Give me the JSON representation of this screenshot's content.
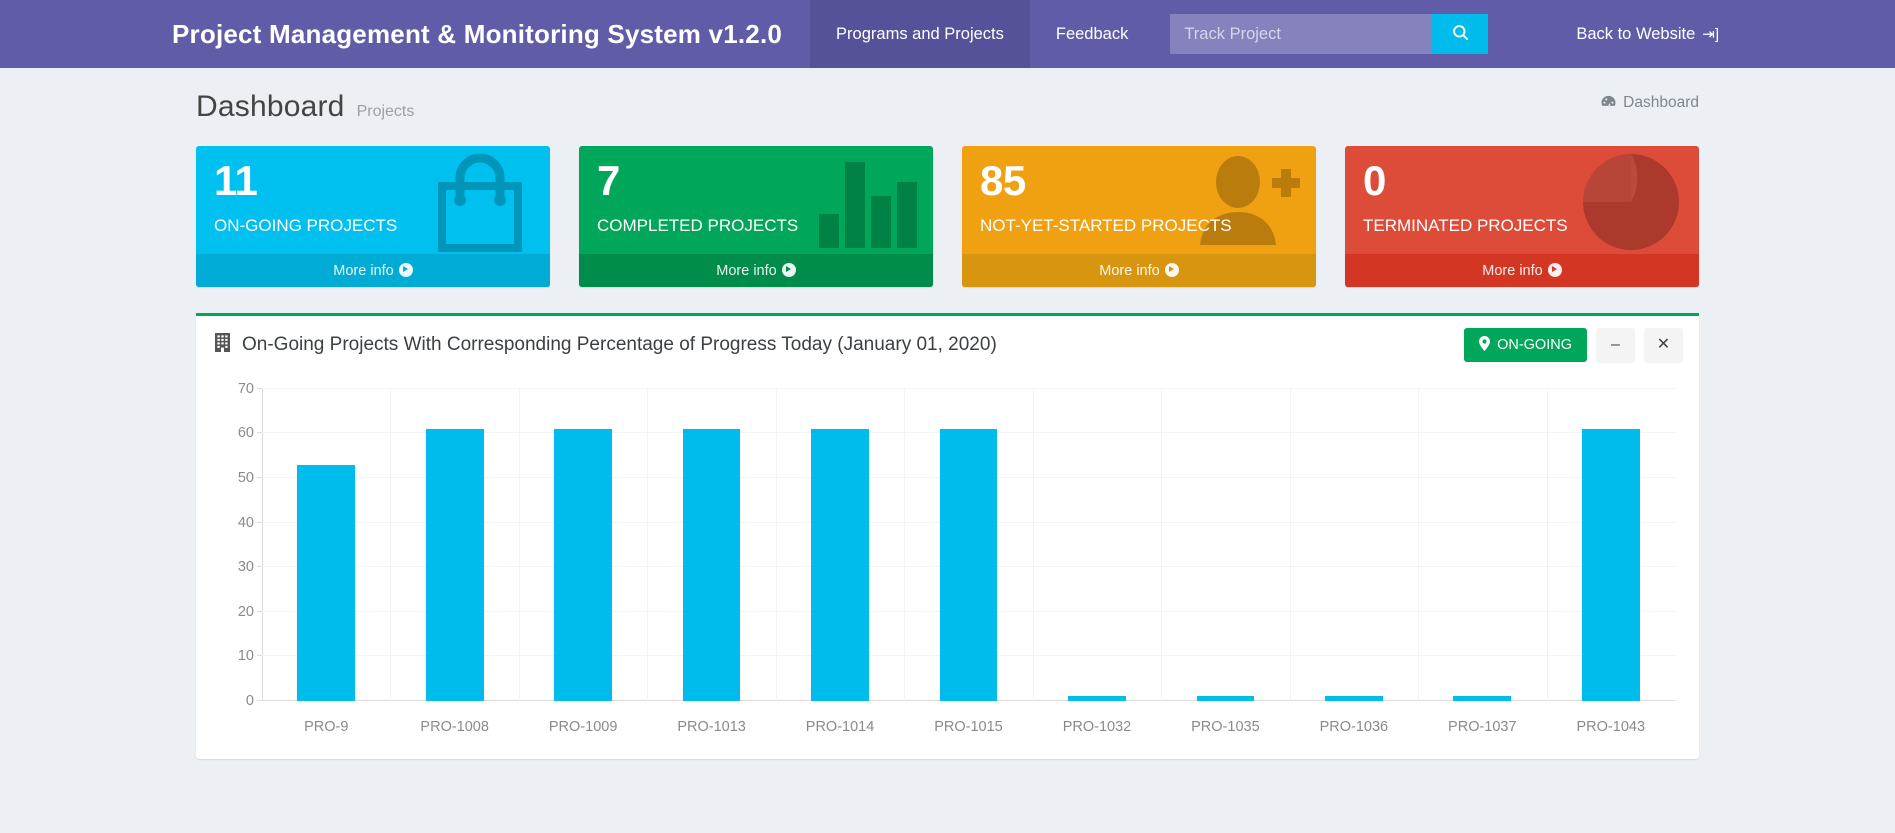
{
  "navbar": {
    "brand": "Project Management & Monitoring System v1.2.0",
    "links": [
      {
        "label": "Programs and Projects",
        "active": true
      },
      {
        "label": "Feedback",
        "active": false
      }
    ],
    "search": {
      "placeholder": "Track Project",
      "value": "",
      "icon": "search-icon",
      "button_color": "#00bcec"
    },
    "right_link": {
      "label": "Back to Website",
      "icon": "sign-out-icon"
    },
    "background": "#605ca8"
  },
  "page": {
    "title": "Dashboard",
    "subtitle": "Projects",
    "breadcrumb": {
      "icon": "dashboard-icon",
      "label": "Dashboard"
    }
  },
  "cards": [
    {
      "value": "11",
      "label": "ON-GOING PROJECTS",
      "more_info": "More info",
      "icon": "shopping-bag-icon",
      "color": "#00c0ef",
      "foot_color": "#00acd6"
    },
    {
      "value": "7",
      "label": "COMPLETED PROJECTS",
      "more_info": "More info",
      "icon": "bar-chart-icon",
      "color": "#00a65a",
      "foot_color": "#008d4c"
    },
    {
      "value": "85",
      "label": "NOT-YET-STARTED PROJECTS",
      "more_info": "More info",
      "icon": "user-plus-icon",
      "color": "#f0a112",
      "foot_color": "#d79510"
    },
    {
      "value": "0",
      "label": "TERMINATED PROJECTS",
      "more_info": "More info",
      "icon": "pie-chart-icon",
      "color": "#dd4b39",
      "foot_color": "#d33724"
    }
  ],
  "panel": {
    "title": "On-Going Projects With Corresponding Percentage of Progress Today (January 01, 2020)",
    "title_icon": "building-icon",
    "status_badge": {
      "label": "ON-GOING",
      "icon": "map-marker-icon",
      "color": "#00a65a"
    },
    "minimize_label": "–",
    "close_label": "✕",
    "accent": "#00a65a"
  },
  "chart_data": {
    "type": "bar",
    "title": "On-Going Projects With Corresponding Percentage of Progress Today (January 01, 2020)",
    "xlabel": "",
    "ylabel": "",
    "categories": [
      "PRO-9",
      "PRO-1008",
      "PRO-1009",
      "PRO-1013",
      "PRO-1014",
      "PRO-1015",
      "PRO-1032",
      "PRO-1035",
      "PRO-1036",
      "PRO-1037",
      "PRO-1043"
    ],
    "values": [
      53,
      61,
      61,
      61,
      61,
      61,
      1,
      1,
      1,
      1,
      61
    ],
    "ylim": [
      0,
      70
    ],
    "yticks": [
      0,
      10,
      20,
      30,
      40,
      50,
      60,
      70
    ],
    "bar_color": "#00bcec",
    "grid": true,
    "legend": false
  }
}
